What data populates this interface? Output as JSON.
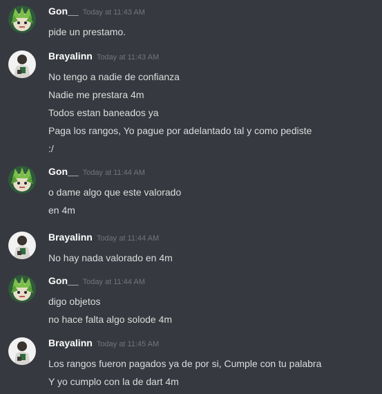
{
  "messages": [
    {
      "author": "Gon__",
      "author_kind": "gon",
      "timestamp": "Today at 11:43 AM",
      "lines": [
        "pide un prestamo."
      ]
    },
    {
      "author": "Brayalinn",
      "author_kind": "brayalinn",
      "timestamp": "Today at 11:43 AM",
      "lines": [
        "No tengo a nadie de confianza",
        "Nadie me prestara 4m",
        "Todos estan baneados ya",
        "Paga los rangos, Yo pague por adelantado tal y como pediste",
        ":/"
      ]
    },
    {
      "author": "Gon__",
      "author_kind": "gon",
      "timestamp": "Today at 11:44 AM",
      "lines": [
        "o dame algo que  este valorado",
        "en 4m"
      ]
    },
    {
      "author": "Brayalinn",
      "author_kind": "brayalinn",
      "timestamp": "Today at 11:44 AM",
      "lines": [
        "No hay nada valorado en 4m"
      ]
    },
    {
      "author": "Gon__",
      "author_kind": "gon",
      "timestamp": "Today at 11:44 AM",
      "lines": [
        "digo objetos",
        "no hace falta algo solode  4m"
      ]
    },
    {
      "author": "Brayalinn",
      "author_kind": "brayalinn",
      "timestamp": "Today at 11:45 AM",
      "lines": [
        "Los rangos fueron pagados ya de por si, Cumple con tu palabra",
        "Y yo cumplo con la de dart 4m"
      ]
    }
  ],
  "colors": {
    "background": "#36393f",
    "username": "#ffffff",
    "timestamp": "#72767d",
    "message_text": "#dcddde"
  }
}
